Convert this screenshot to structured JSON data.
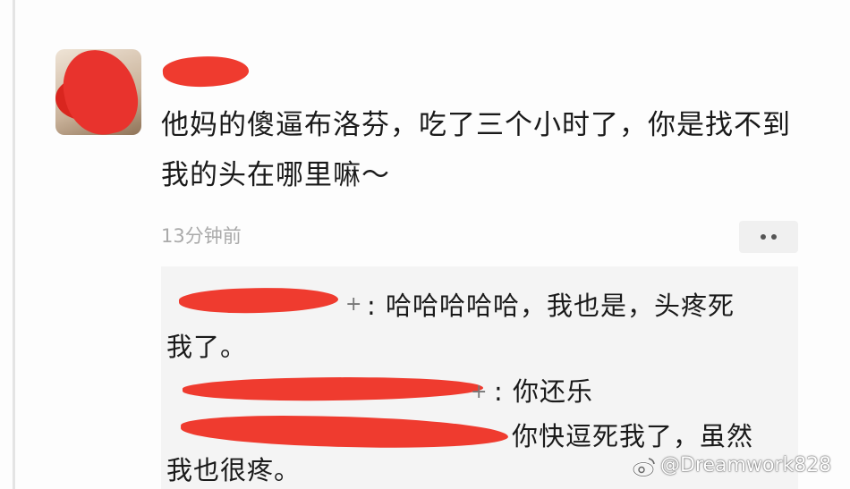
{
  "post": {
    "text": "他妈的傻逼布洛芬，吃了三个小时了，你是找不到我的头在哪里嘛～",
    "time": "13分钟前"
  },
  "comments": [
    {
      "sep": ":",
      "text": "哈哈哈哈哈，我也是，头疼死"
    },
    {
      "text": "我了。"
    },
    {
      "sep": ":",
      "text": "你还乐"
    },
    {
      "text": "你快逗死我了，虽然"
    },
    {
      "text": "我也很疼。"
    }
  ],
  "watermark": "@Dreamwork828",
  "icons": {
    "more": "more-dots-icon",
    "weibo": "weibo-icon",
    "plus": "+"
  },
  "colors": {
    "redaction": "#ef3b2f",
    "timestamp": "#aaaaaa",
    "comment_bg": "#f4f4f4"
  }
}
